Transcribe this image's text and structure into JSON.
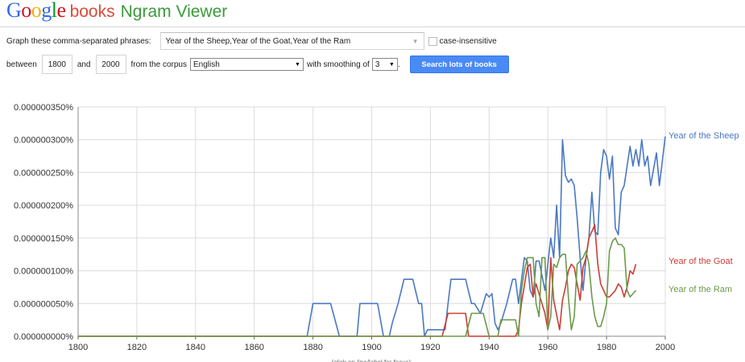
{
  "header": {
    "logo_letters": [
      {
        "ch": "G",
        "color": "#3369e8"
      },
      {
        "ch": "o",
        "color": "#d50f25"
      },
      {
        "ch": "o",
        "color": "#eeb211"
      },
      {
        "ch": "g",
        "color": "#3369e8"
      },
      {
        "ch": "l",
        "color": "#009925"
      },
      {
        "ch": "e",
        "color": "#d50f25"
      }
    ],
    "logo_suffix": "books",
    "title": "Ngram Viewer"
  },
  "form": {
    "phrases_label": "Graph these comma-separated phrases:",
    "phrases_value": "Year of the Sheep,Year of the Goat,Year of the Ram",
    "case_insensitive_label": "case-insensitive",
    "case_insensitive_checked": false,
    "between_label": "between",
    "year_start": "1800",
    "and_label": "and",
    "year_end": "2000",
    "corpus_label": "from the corpus",
    "corpus_value": "English",
    "smoothing_label": "with smoothing of",
    "smoothing_value": "3",
    "smoothing_suffix": ".",
    "search_button": "Search lots of books"
  },
  "chart_data": {
    "type": "line",
    "y_tick_labels": [
      "0.000000000%",
      "0.000000050%",
      "0.000000100%",
      "0.000000150%",
      "0.000000200%",
      "0.000000250%",
      "0.000000300%",
      "0.000000350%"
    ],
    "x_tick_labels": [
      "1800",
      "1820",
      "1840",
      "1860",
      "1880",
      "1900",
      "1920",
      "1940",
      "1960",
      "1980",
      "2000"
    ],
    "xlim": [
      1800,
      2000
    ],
    "ylim": [
      0,
      3.5e-09
    ],
    "grid": true,
    "footer_note": "(click on line/label for focus)",
    "series": [
      {
        "name": "Year of the Sheep",
        "color": "#4a78c2",
        "points": [
          [
            1800,
            0
          ],
          [
            1878,
            0
          ],
          [
            1880,
            5e-10
          ],
          [
            1886,
            5e-10
          ],
          [
            1889,
            0
          ],
          [
            1895,
            0
          ],
          [
            1896,
            5e-10
          ],
          [
            1902,
            5e-10
          ],
          [
            1904,
            0
          ],
          [
            1906,
            0
          ],
          [
            1907,
            2e-10
          ],
          [
            1909,
            5e-10
          ],
          [
            1911,
            8.7e-10
          ],
          [
            1914,
            8.7e-10
          ],
          [
            1916,
            5e-10
          ],
          [
            1917,
            5e-10
          ],
          [
            1918,
            0
          ],
          [
            1919,
            1e-10
          ],
          [
            1925,
            1e-10
          ],
          [
            1926,
            5e-10
          ],
          [
            1927,
            8.7e-10
          ],
          [
            1932,
            8.7e-10
          ],
          [
            1934,
            5e-10
          ],
          [
            1935,
            5e-10
          ],
          [
            1937,
            3.5e-10
          ],
          [
            1939,
            6.5e-10
          ],
          [
            1940,
            6e-10
          ],
          [
            1941,
            6.5e-10
          ],
          [
            1942,
            2e-10
          ],
          [
            1943,
            1e-10
          ],
          [
            1944,
            2e-10
          ],
          [
            1946,
            5e-10
          ],
          [
            1948,
            8.7e-10
          ],
          [
            1949,
            8.7e-10
          ],
          [
            1950,
            5e-10
          ],
          [
            1952,
            1.2e-09
          ],
          [
            1953,
            1.15e-09
          ],
          [
            1954,
            7e-10
          ],
          [
            1955,
            6e-10
          ],
          [
            1956,
            1.15e-09
          ],
          [
            1957,
            1.15e-09
          ],
          [
            1959,
            7e-10
          ],
          [
            1960,
            1.1e-09
          ],
          [
            1961,
            1.5e-09
          ],
          [
            1962,
            1.2e-09
          ],
          [
            1963,
            2e-09
          ],
          [
            1964,
            1.2e-09
          ],
          [
            1965,
            3e-09
          ],
          [
            1966,
            2.45e-09
          ],
          [
            1967,
            2.35e-09
          ],
          [
            1968,
            2.4e-09
          ],
          [
            1969,
            2.3e-09
          ],
          [
            1970,
            1.8e-09
          ],
          [
            1971,
            1.2e-09
          ],
          [
            1972,
            7e-10
          ],
          [
            1973,
            1.2e-09
          ],
          [
            1974,
            1.5e-09
          ],
          [
            1975,
            2.2e-09
          ],
          [
            1976,
            1.6e-09
          ],
          [
            1977,
            1.55e-09
          ],
          [
            1978,
            2.5e-09
          ],
          [
            1979,
            2.85e-09
          ],
          [
            1980,
            2.75e-09
          ],
          [
            1981,
            2.4e-09
          ],
          [
            1982,
            2.75e-09
          ],
          [
            1983,
            1.65e-09
          ],
          [
            1984,
            1.55e-09
          ],
          [
            1985,
            2.2e-09
          ],
          [
            1986,
            2.3e-09
          ],
          [
            1988,
            2.9e-09
          ],
          [
            1989,
            2.6e-09
          ],
          [
            1990,
            2.85e-09
          ],
          [
            1991,
            2.6e-09
          ],
          [
            1992,
            3e-09
          ],
          [
            1993,
            2.6e-09
          ],
          [
            1994,
            2.75e-09
          ],
          [
            1995,
            2.3e-09
          ],
          [
            1997,
            2.8e-09
          ],
          [
            1998,
            2.3e-09
          ],
          [
            2000,
            3.05e-09
          ]
        ]
      },
      {
        "name": "Year of the Goat",
        "color": "#cc3d34",
        "points": [
          [
            1800,
            0
          ],
          [
            1924,
            0
          ],
          [
            1926,
            3.5e-10
          ],
          [
            1932,
            3.5e-10
          ],
          [
            1933,
            0
          ],
          [
            1949,
            0
          ],
          [
            1950,
            1e-10
          ],
          [
            1951,
            5e-10
          ],
          [
            1953,
            1.05e-09
          ],
          [
            1954,
            1.1e-09
          ],
          [
            1955,
            6e-10
          ],
          [
            1956,
            8e-10
          ],
          [
            1958,
            5e-10
          ],
          [
            1959,
            3.5e-10
          ],
          [
            1960,
            1e-10
          ],
          [
            1961,
            1.2e-09
          ],
          [
            1962,
            5.5e-10
          ],
          [
            1964,
            1e-10
          ],
          [
            1965,
            5.5e-10
          ],
          [
            1966,
            7.5e-10
          ],
          [
            1967,
            1e-09
          ],
          [
            1968,
            1.1e-09
          ],
          [
            1969,
            1.05e-09
          ],
          [
            1970,
            8e-10
          ],
          [
            1971,
            5.5e-10
          ],
          [
            1972,
            1.05e-09
          ],
          [
            1973,
            1.2e-09
          ],
          [
            1974,
            1.5e-09
          ],
          [
            1975,
            1.6e-09
          ],
          [
            1976,
            1.7e-09
          ],
          [
            1977,
            1.1e-09
          ],
          [
            1978,
            8e-10
          ],
          [
            1979,
            7e-10
          ],
          [
            1980,
            6e-10
          ],
          [
            1981,
            6e-10
          ],
          [
            1982,
            6.5e-10
          ],
          [
            1983,
            7e-10
          ],
          [
            1984,
            8e-10
          ],
          [
            1985,
            7.5e-10
          ],
          [
            1986,
            6e-10
          ],
          [
            1987,
            7.5e-10
          ],
          [
            1988,
            1e-09
          ],
          [
            1989,
            9.5e-10
          ],
          [
            1990,
            1.1e-09
          ]
        ]
      },
      {
        "name": "Year of the Ram",
        "color": "#6c9a4a",
        "points": [
          [
            1800,
            0
          ],
          [
            1932,
            0
          ],
          [
            1934,
            3.5e-10
          ],
          [
            1938,
            3.5e-10
          ],
          [
            1940,
            0
          ],
          [
            1943,
            0
          ],
          [
            1944,
            2.5e-10
          ],
          [
            1949,
            2.5e-10
          ],
          [
            1950,
            0
          ],
          [
            1951,
            7e-10
          ],
          [
            1952,
            1e-09
          ],
          [
            1953,
            1.2e-09
          ],
          [
            1955,
            1.2e-09
          ],
          [
            1956,
            5e-10
          ],
          [
            1957,
            3e-10
          ],
          [
            1958,
            1.2e-09
          ],
          [
            1959,
            1.2e-09
          ],
          [
            1960,
            1e-10
          ],
          [
            1961,
            3e-10
          ],
          [
            1962,
            1.1e-09
          ],
          [
            1963,
            1.05e-09
          ],
          [
            1964,
            1.2e-09
          ],
          [
            1965,
            1.25e-09
          ],
          [
            1966,
            1.25e-09
          ],
          [
            1967,
            6e-10
          ],
          [
            1968,
            1e-10
          ],
          [
            1969,
            3e-10
          ],
          [
            1970,
            1.1e-09
          ],
          [
            1971,
            1.15e-09
          ],
          [
            1972,
            1.2e-09
          ],
          [
            1973,
            1.3e-09
          ],
          [
            1974,
            1.1e-09
          ],
          [
            1975,
            6e-10
          ],
          [
            1976,
            3e-10
          ],
          [
            1977,
            1.5e-10
          ],
          [
            1978,
            1.5e-10
          ],
          [
            1979,
            3e-10
          ],
          [
            1980,
            5e-10
          ],
          [
            1981,
            1.3e-09
          ],
          [
            1982,
            1.45e-09
          ],
          [
            1983,
            1.5e-09
          ],
          [
            1984,
            1.4e-09
          ],
          [
            1985,
            1.4e-09
          ],
          [
            1986,
            1.35e-09
          ],
          [
            1987,
            7e-10
          ],
          [
            1988,
            6e-10
          ],
          [
            1990,
            7e-10
          ]
        ]
      }
    ]
  }
}
